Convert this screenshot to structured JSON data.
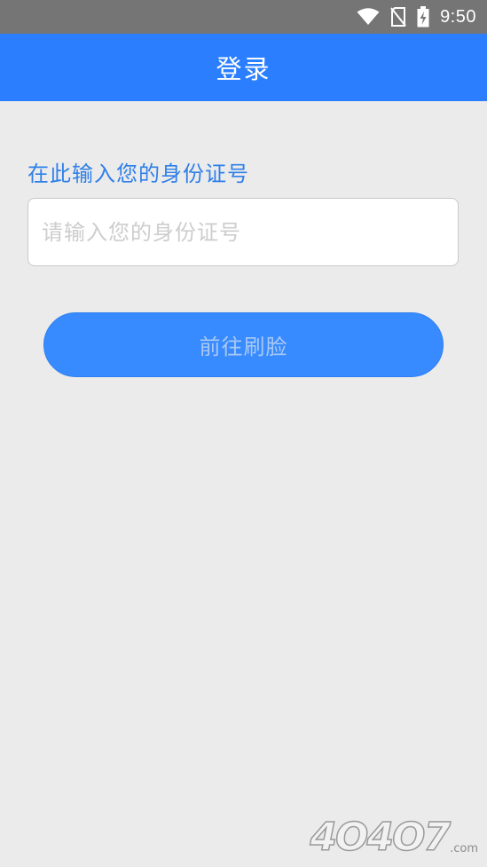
{
  "status_bar": {
    "time": "9:50",
    "icons": [
      "wifi-icon",
      "no-sim-icon",
      "battery-charging-icon"
    ]
  },
  "app_bar": {
    "title": "登录"
  },
  "form": {
    "id_label": "在此输入您的身份证号",
    "id_input": {
      "value": "",
      "placeholder": "请输入您的身份证号"
    },
    "submit_label": "前往刷脸"
  },
  "watermark": {
    "text": "4O4O7",
    "suffix": ".com"
  },
  "colors": {
    "primary": "#2b7fff",
    "status_bar": "#757575",
    "background": "#ebebeb",
    "label": "#2f80e8"
  }
}
